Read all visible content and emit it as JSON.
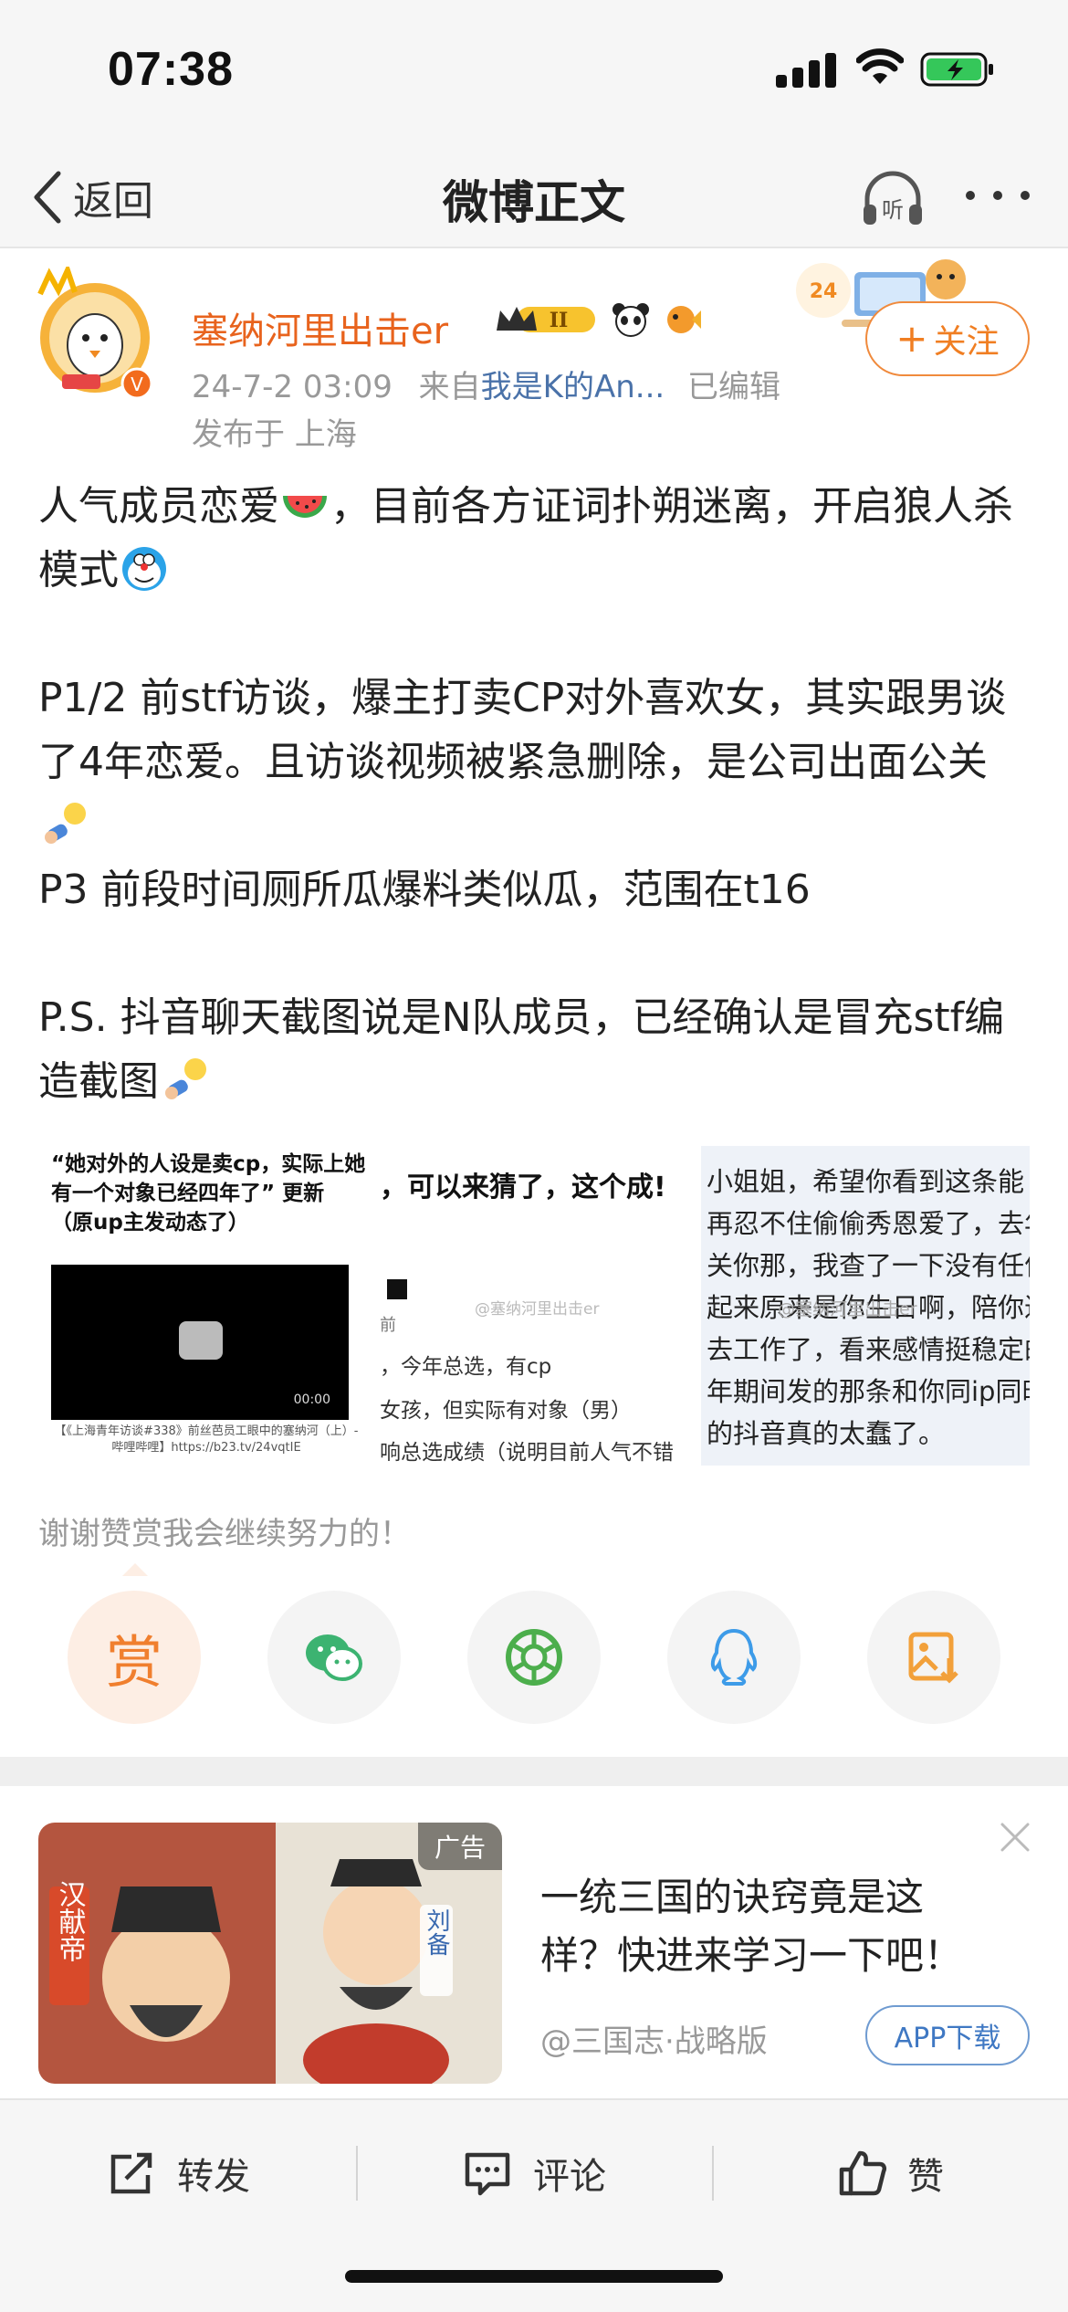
{
  "status_bar": {
    "time": "07:38"
  },
  "nav": {
    "back_label": "返回",
    "title": "微博正文"
  },
  "author": {
    "name": "塞纳河里出击er",
    "badge_level": "II",
    "timestamp": "24-7-2 03:09",
    "source_prefix": "来自",
    "source": "我是K的An...",
    "edited": "已编辑",
    "location": "发布于 上海",
    "deco_text": "24",
    "follow_label": "关注"
  },
  "post": {
    "p1_a": "人气成员恋爱",
    "p1_b": "，目前各方证词扑朔迷离，开启狼人杀模式",
    "p2": "P1/2 前stf访谈，爆主打卖CP对外喜欢女，其实跟男谈了4年恋爱。且访谈视频被紧急删除，是公司出面公关",
    "p3": "P3 前段时间厕所瓜爆料类似瓜，范围在t16",
    "p4": "P.S. 抖音聊天截图说是N队成员，已经确认是冒充stf编造截图"
  },
  "images": {
    "img1_caption": "“她对外的人设是卖cp，实际上她有一个对象已经四年了” 更新 （原up主发动态了）",
    "img1_duration": "00:00",
    "img1_footer": "【《上海青年访谈#338》前丝芭员工眼中的塞纳河（上）-哔哩哔哩】https://b23.tv/24vqtIE",
    "img2_head": "，可以来猜了，这个成!",
    "img2_line0": "前",
    "img2_line1": "，今年总选，有cp",
    "img2_line2": "女孩，但实际有对象（男）",
    "img2_line3": "响总选成绩（说明目前人气不错",
    "img2_watermark": "@塞纳河里出击er",
    "img3_lines": [
      "小姐姐，希望你看到这条能",
      "再忍不住偷偷秀恩爱了，去年",
      "关你那，我查了一下没有任何",
      "起来原来是你生日啊，陪你过",
      "去工作了，看来感情挺稳定的",
      "年期间发的那条和你同ip同时",
      "的抖音真的太蠢了。"
    ],
    "img3_watermark": "@塞纳河里出击er"
  },
  "reward": {
    "thanks": "谢谢赞赏我会继续努力的！",
    "reward_char": "赏",
    "share_targets": [
      "wechat-icon",
      "moments-icon",
      "qq-icon",
      "save-image-icon"
    ]
  },
  "ad": {
    "tag": "广告",
    "title": "一统三国的诀窍竟是这样？快进来学习一下吧！",
    "source": "@三国志·战略版",
    "button": "APP下载",
    "image_text_left": "汉献帝",
    "image_text_right": "刘备"
  },
  "actions": {
    "repost": "转发",
    "comment": "评论",
    "like": "赞"
  },
  "colors": {
    "accent": "#f07e22",
    "link": "#4a72a9",
    "ad_button": "#3f78c3"
  }
}
